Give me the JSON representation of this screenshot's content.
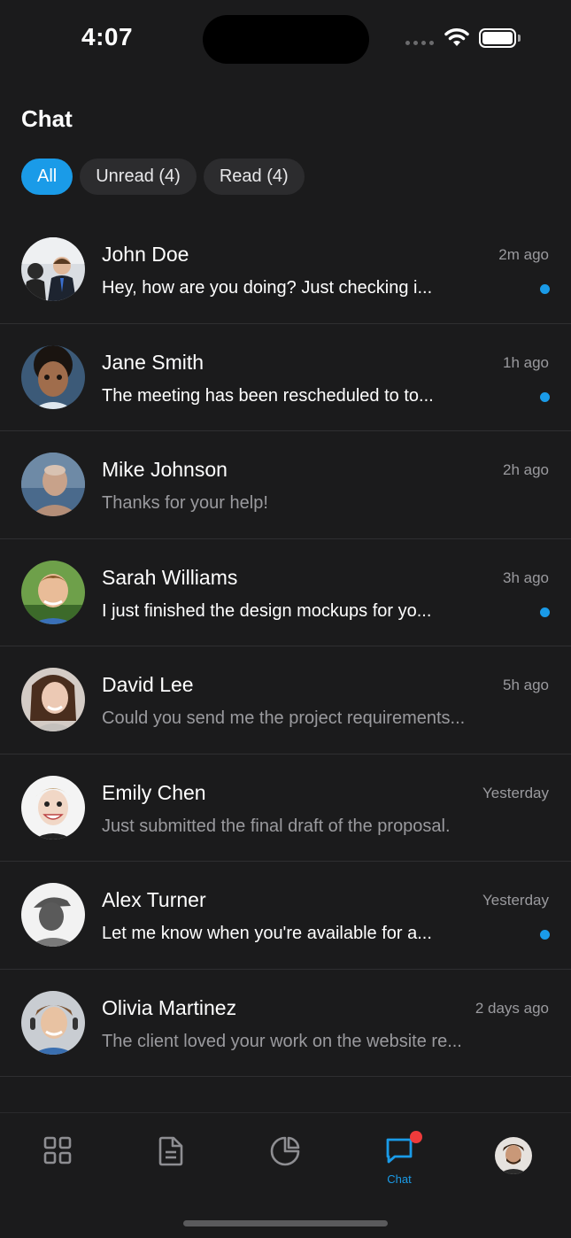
{
  "status_bar": {
    "time": "4:07"
  },
  "header": {
    "title": "Chat"
  },
  "filters": [
    {
      "label": "All",
      "active": true
    },
    {
      "label": "Unread (4)",
      "active": false
    },
    {
      "label": "Read (4)",
      "active": false
    }
  ],
  "chats": [
    {
      "name": "John Doe",
      "time": "2m ago",
      "preview": "Hey, how are you doing? Just checking i...",
      "unread": true
    },
    {
      "name": "Jane Smith",
      "time": "1h ago",
      "preview": "The meeting has been rescheduled to to...",
      "unread": true
    },
    {
      "name": "Mike Johnson",
      "time": "2h ago",
      "preview": "Thanks for your help!",
      "unread": false
    },
    {
      "name": "Sarah Williams",
      "time": "3h ago",
      "preview": "I just finished the design mockups for yo...",
      "unread": true
    },
    {
      "name": "David Lee",
      "time": "5h ago",
      "preview": "Could you send me the project requirements...",
      "unread": false
    },
    {
      "name": "Emily Chen",
      "time": "Yesterday",
      "preview": "Just submitted the final draft of the proposal.",
      "unread": false
    },
    {
      "name": "Alex Turner",
      "time": "Yesterday",
      "preview": "Let me know when you're available for a...",
      "unread": true
    },
    {
      "name": "Olivia Martinez",
      "time": "2 days ago",
      "preview": "The client loved your work on the website re...",
      "unread": false
    }
  ],
  "tab_bar": {
    "tabs": [
      {
        "icon": "grid-icon"
      },
      {
        "icon": "document-icon"
      },
      {
        "icon": "pie-chart-icon"
      },
      {
        "icon": "chat-bubble-icon",
        "label": "Chat",
        "active": true,
        "badge": true
      },
      {
        "icon": "profile-avatar"
      }
    ]
  },
  "colors": {
    "accent": "#1a9be8",
    "background": "#1b1b1c",
    "badge": "#ee3b3b",
    "muted_text": "#9a9a9e"
  }
}
